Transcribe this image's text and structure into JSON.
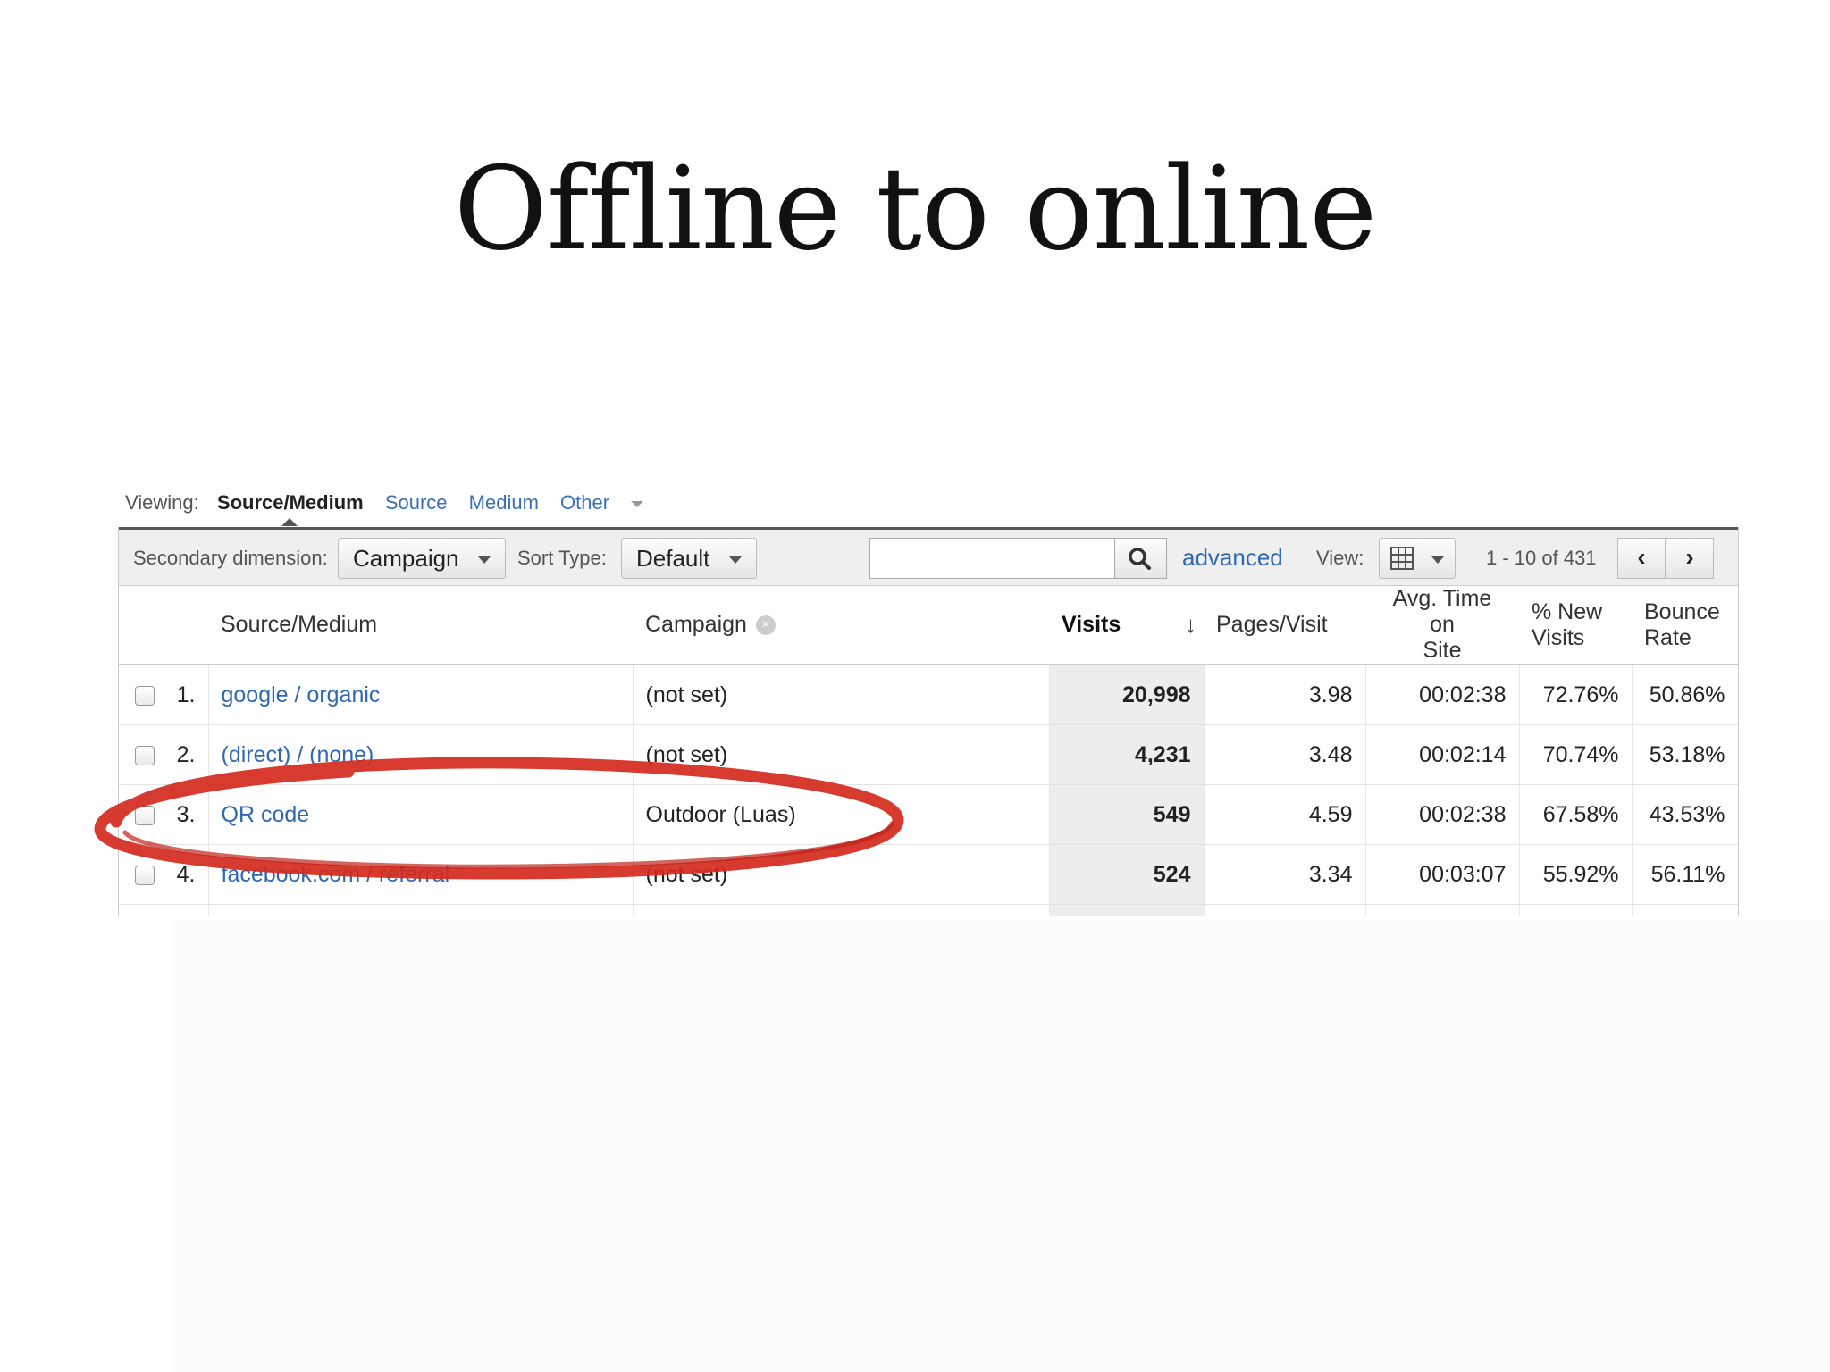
{
  "slide_title": "Offline to online",
  "viewing": {
    "label": "Viewing:",
    "active": "Source/Medium",
    "links": [
      "Source",
      "Medium",
      "Other"
    ]
  },
  "toolbar": {
    "secondary_label": "Secondary dimension:",
    "secondary_value": "Campaign",
    "sort_label": "Sort Type:",
    "sort_value": "Default",
    "search_value": "",
    "advanced": "advanced",
    "view_label": "View:",
    "pagination": "1 - 10 of 431",
    "prev": "‹",
    "next": "›"
  },
  "table": {
    "headers": {
      "source": "Source/Medium",
      "campaign": "Campaign",
      "visits": "Visits",
      "pages": "Pages/Visit",
      "avg_time_1": "Avg. Time on",
      "avg_time_2": "Site",
      "new_visits_1": "% New",
      "new_visits_2": "Visits",
      "bounce_1": "Bounce",
      "bounce_2": "Rate"
    },
    "rows": [
      {
        "rank": "1.",
        "source": "google / organic",
        "campaign": "(not set)",
        "visits": "20,998",
        "pages": "3.98",
        "time": "00:02:38",
        "new": "72.76%",
        "bounce": "50.86%"
      },
      {
        "rank": "2.",
        "source": "(direct) / (none)",
        "campaign": "(not set)",
        "visits": "4,231",
        "pages": "3.48",
        "time": "00:02:14",
        "new": "70.74%",
        "bounce": "53.18%"
      },
      {
        "rank": "3.",
        "source": "QR code",
        "campaign": "Outdoor (Luas)",
        "visits": "549",
        "pages": "4.59",
        "time": "00:02:38",
        "new": "67.58%",
        "bounce": "43.53%"
      },
      {
        "rank": "4.",
        "source": "facebook.com / referral",
        "campaign": "(not set)",
        "visits": "524",
        "pages": "3.34",
        "time": "00:03:07",
        "new": "55.92%",
        "bounce": "56.11%"
      }
    ]
  },
  "colors": {
    "link": "#2f68b0",
    "highlight": "#d42a1e"
  }
}
